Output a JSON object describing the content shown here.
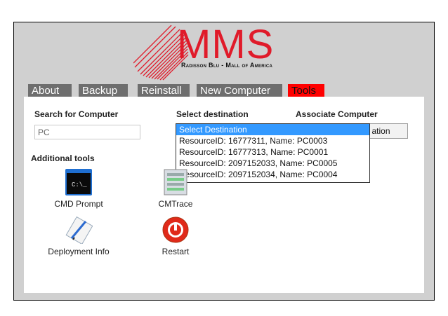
{
  "logo": {
    "title": "MMS",
    "subtitle": "Radisson Blu - Mall of America"
  },
  "tabs": [
    {
      "label": "About"
    },
    {
      "label": "Backup"
    },
    {
      "label": "Reinstall"
    },
    {
      "label": "New Computer"
    },
    {
      "label": "Tools",
      "active": true
    }
  ],
  "search": {
    "heading": "Search for Computer",
    "value": "PC"
  },
  "destination": {
    "heading": "Select destination",
    "options": [
      "Select Destination",
      "ResourceID: 16777311,   Name: PC0003",
      "ResourceID: 16777313,   Name: PC0001",
      "ResourceID: 2097152033,   Name: PC0005",
      "ResourceID: 2097152034,   Name: PC0004"
    ],
    "selected_index": 0
  },
  "associate": {
    "heading": "Associate Computer",
    "button_label": "ation"
  },
  "tools": {
    "heading": "Additional tools",
    "items": [
      {
        "label": "CMD Prompt",
        "icon": "cmd-prompt-icon"
      },
      {
        "label": "CMTrace",
        "icon": "cmtrace-icon"
      },
      {
        "label": "Deployment Info",
        "icon": "deployment-info-icon"
      },
      {
        "label": "Restart",
        "icon": "restart-icon"
      }
    ]
  },
  "colors": {
    "accent": "#e01b2a",
    "active_tab": "#ff0000",
    "tab": "#6e6e6e",
    "selection": "#3399ff",
    "frame_bg": "#d0d0d0"
  }
}
